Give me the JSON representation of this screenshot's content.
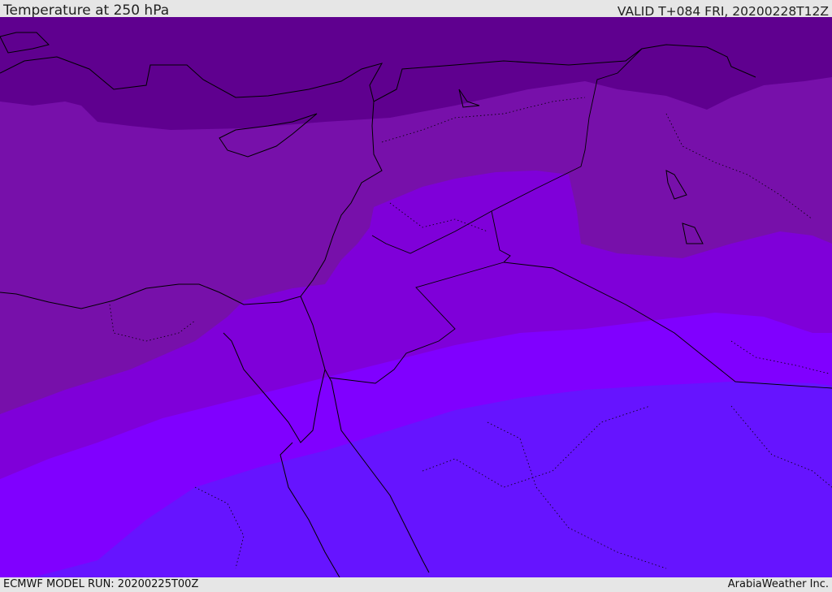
{
  "header": {
    "title": "Temperature at 250 hPa",
    "valid": "VALID T+084 FRI, 20200228T12Z"
  },
  "footer": {
    "model_run": "ECMWF MODEL RUN: 20200225T00Z",
    "credit": "ArabiaWeather Inc."
  },
  "map": {
    "field": "Temperature",
    "level": "250 hPa",
    "shading_colors": [
      "#5f008f",
      "#7710aa",
      "#7f00d9",
      "#8000ff",
      "#6614ff"
    ],
    "boundary_color": "#000000"
  }
}
